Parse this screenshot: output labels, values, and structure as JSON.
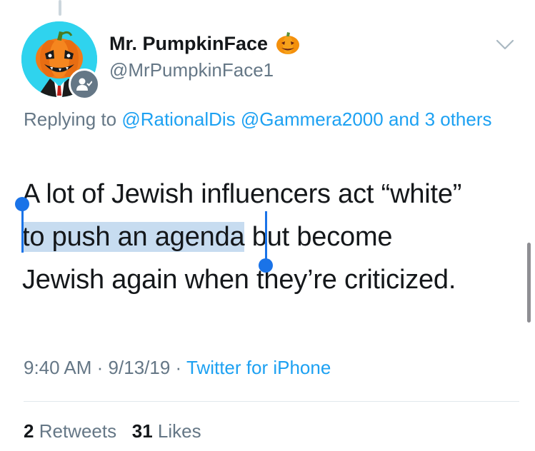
{
  "tweet": {
    "display_name": "Mr. PumpkinFace",
    "handle": "@MrPumpkinFace1",
    "replying_prefix": "Replying to",
    "replying_mentions": [
      "@RationalDis",
      "@Gammera2000"
    ],
    "replying_and": "and",
    "replying_others": "3 others",
    "text_lines": [
      {
        "before": "A lot of Jewish influencers act “white”",
        "selected": "",
        "after": ""
      },
      {
        "before": "",
        "selected": "to push an agenda",
        "after": " but become"
      },
      {
        "before": "Jewish again when they’re criticized.",
        "selected": "",
        "after": ""
      }
    ],
    "time": "9:40 AM",
    "date": "9/13/19",
    "separator": "·",
    "source": "Twitter for iPhone",
    "retweets_count": "2",
    "retweets_label": "Retweets",
    "likes_count": "31",
    "likes_label": "Likes"
  },
  "icons": {
    "avatar": "pumpkin-avatar",
    "badge": "user-follow-icon",
    "name_emoji": "jack-o-lantern-icon",
    "menu": "chevron-down-icon"
  },
  "colors": {
    "link": "#1da1f2",
    "secondary_text": "#657786",
    "primary_text": "#14171a",
    "selection": "#c7dcf0",
    "selection_handle": "#1a73e8",
    "avatar_bg": "#2fd3ee"
  }
}
